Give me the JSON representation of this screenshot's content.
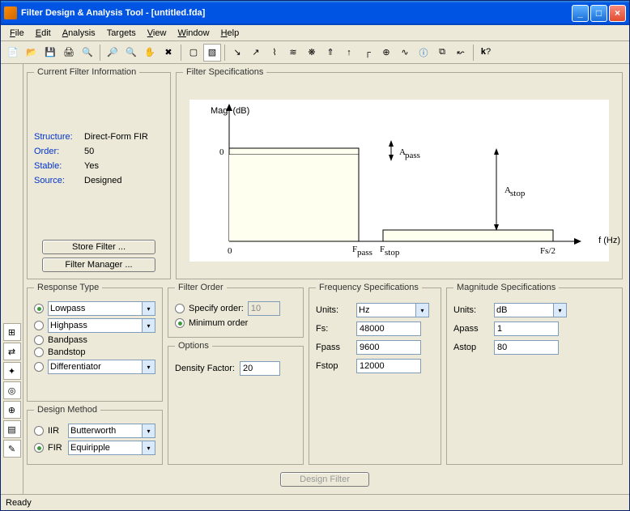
{
  "window": {
    "title": "Filter Design & Analysis Tool - [untitled.fda]"
  },
  "menu": {
    "file": "File",
    "edit": "Edit",
    "analysis": "Analysis",
    "targets": "Targets",
    "view": "View",
    "window": "Window",
    "help": "Help"
  },
  "cfi": {
    "legend": "Current Filter Information",
    "structure_label": "Structure:",
    "structure_value": "Direct-Form FIR",
    "order_label": "Order:",
    "order_value": "50",
    "stable_label": "Stable:",
    "stable_value": "Yes",
    "source_label": "Source:",
    "source_value": "Designed",
    "store_btn": "Store Filter ...",
    "manager_btn": "Filter Manager ..."
  },
  "fspec": {
    "legend": "Filter Specifications",
    "ylabel": "Mag. (dB)",
    "xlabel": "f (Hz)",
    "zero": "0",
    "fpass": "F",
    "fpass_sub": "pass",
    "fstop": "F",
    "fstop_sub": "stop",
    "fs2": "Fs/2",
    "apass": "A",
    "apass_sub": "pass",
    "astop": "A",
    "astop_sub": "stop"
  },
  "rt": {
    "legend": "Response Type",
    "lowpass": "Lowpass",
    "highpass": "Highpass",
    "bandpass": "Bandpass",
    "bandstop": "Bandstop",
    "diff": "Differentiator"
  },
  "dm": {
    "legend": "Design Method",
    "iir": "IIR",
    "iir_val": "Butterworth",
    "fir": "FIR",
    "fir_val": "Equiripple"
  },
  "fo": {
    "legend": "Filter Order",
    "specify": "Specify order:",
    "specify_val": "10",
    "min": "Minimum order"
  },
  "opt": {
    "legend": "Options",
    "density": "Density Factor:",
    "density_val": "20"
  },
  "freq": {
    "legend": "Frequency Specifications",
    "units_label": "Units:",
    "units_val": "Hz",
    "fs_label": "Fs:",
    "fs_val": "48000",
    "fpass_label": "Fpass",
    "fpass_val": "9600",
    "fstop_label": "Fstop",
    "fstop_val": "12000"
  },
  "mag": {
    "legend": "Magnitude Specifications",
    "units_label": "Units:",
    "units_val": "dB",
    "apass_label": "Apass",
    "apass_val": "1",
    "astop_label": "Astop",
    "astop_val": "80"
  },
  "design_btn": "Design Filter",
  "status": "Ready"
}
